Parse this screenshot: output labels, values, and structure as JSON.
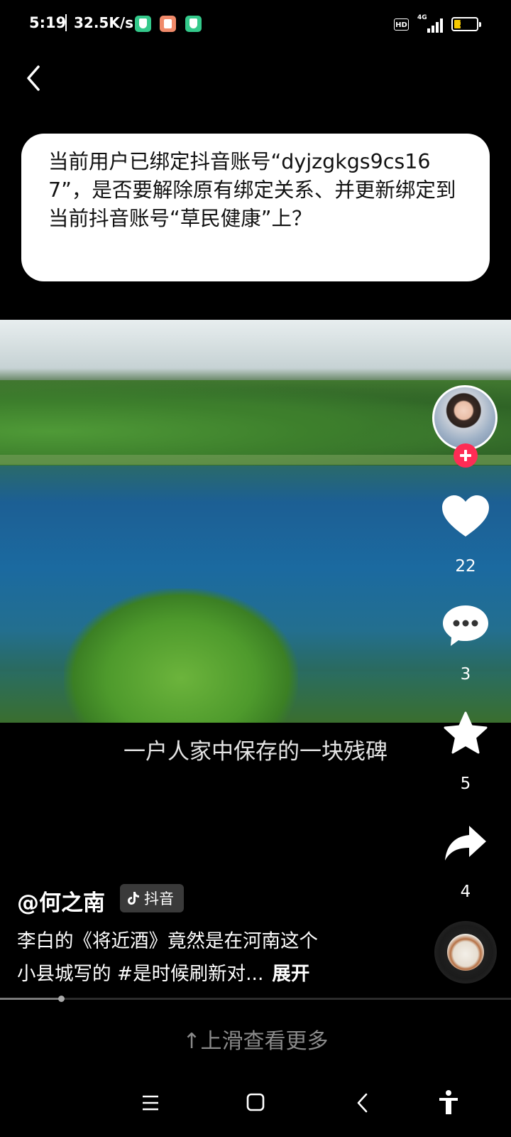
{
  "status_bar": {
    "time": "5:19",
    "net_speed": "32.5K/s",
    "hd_badge": "HD",
    "network_type": "4G",
    "battery_level": "31",
    "battery_fraction": 0.31,
    "battery_color": "#f5c900",
    "app_icons": [
      "shield-icon",
      "clipboard-icon",
      "shield-icon"
    ]
  },
  "header": {
    "back_icon": "chevron-left-icon"
  },
  "dialog": {
    "message": "当前用户已绑定抖音账号“dyjzgkgs9cs167”，是否要解除原有绑定关系、并更新绑定到当前抖音账号“草民健康”上？"
  },
  "video": {
    "subtitle": "一户人家中保存的一块残碑"
  },
  "actions": {
    "like_count": "22",
    "comment_count": "3",
    "favorite_count": "5",
    "share_count": "4",
    "follow_color": "#fe2c55"
  },
  "post": {
    "author": "@何之南",
    "platform_tag": "抖音",
    "caption_line1": "李白的《将近酒》竟然是在河南这个",
    "caption_line2": "小县城写的 #是时候刷新对...",
    "expand_label": "展开"
  },
  "playback": {
    "progress_fraction": 0.12
  },
  "footer": {
    "swipe_hint": "↑上滑查看更多"
  },
  "nav_bar": {
    "icons": [
      "menu-icon",
      "home-square-icon",
      "back-chevron-icon",
      "accessibility-icon"
    ]
  }
}
